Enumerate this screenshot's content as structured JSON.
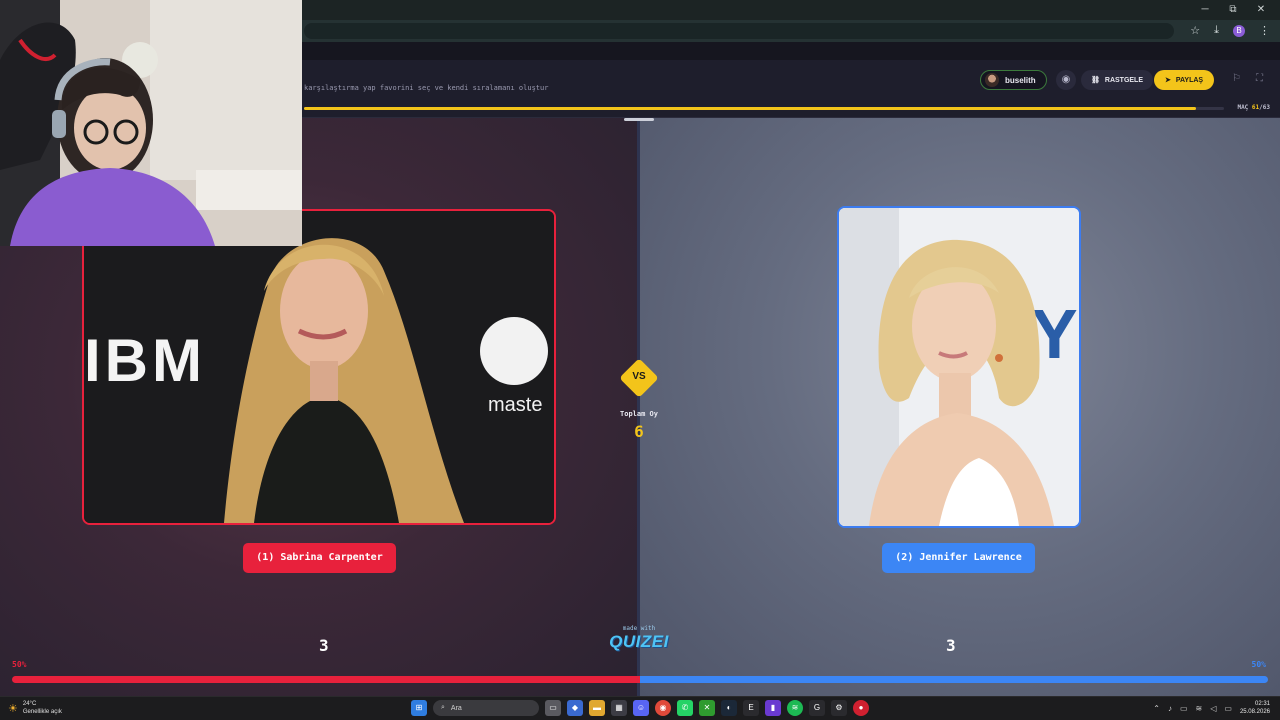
{
  "browser": {
    "window_controls": [
      "─",
      "⧉",
      "✕"
    ],
    "profile_initial": "B"
  },
  "header": {
    "subtitle": "karşılaştırma yap favorini seç ve kendi sıralamanı oluştur",
    "username": "buselith",
    "random_label": "RASTGELE",
    "share_label": "PAYLAŞ",
    "match_prefix": "MAÇ",
    "match_current": "61",
    "match_total": "/63",
    "progress": 0.97
  },
  "arena": {
    "left": {
      "name": "(1) Sabrina Carpenter",
      "score": "3",
      "percent": "50%",
      "color": "#e8213c",
      "share": 0.5
    },
    "right": {
      "name": "(2) Jennifer Lawrence",
      "score": "3",
      "percent": "50%",
      "color": "#3c86f5",
      "share": 0.5
    },
    "vs": "VS",
    "total_label": "Toplam Oy",
    "total_value": "6",
    "made_with": "made with",
    "brand": "QUIZEI",
    "left_photo_text": {
      "brand1": "IBM",
      "brand2": "maste"
    },
    "right_photo_text": "Y"
  },
  "taskbar": {
    "weather_temp": "24°C",
    "weather_desc": "Genellikle açık",
    "search_placeholder": "Ara",
    "time": "02:31",
    "date": "25.08.2026"
  }
}
